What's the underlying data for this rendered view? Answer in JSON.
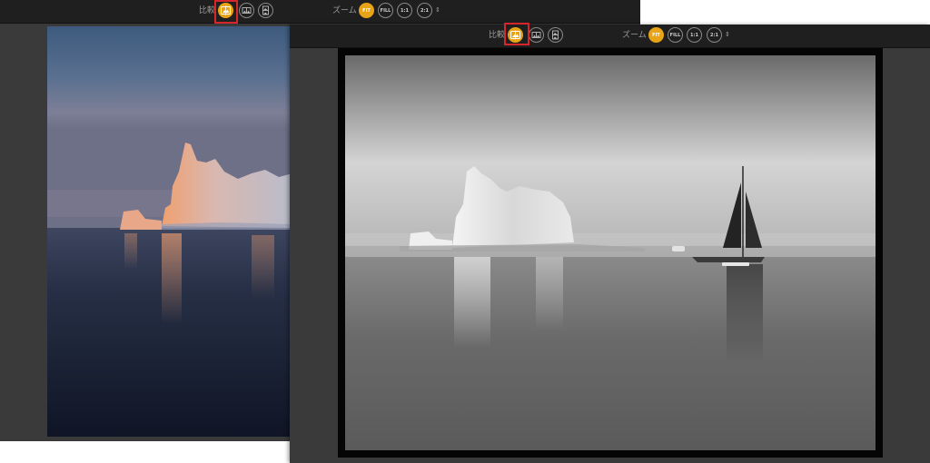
{
  "back_window": {
    "compare_label": "比較",
    "zoom_label": "ズーム",
    "zoom_options": [
      "FIT",
      "FILL",
      "1:1",
      "2:1"
    ],
    "zoom_spinner": "⇕"
  },
  "front_window": {
    "compare_label": "比較",
    "zoom_label": "ズーム",
    "zoom_options": [
      "FIT",
      "FILL",
      "1:1",
      "2:1"
    ],
    "zoom_spinner": "⇕"
  },
  "colors": {
    "accent": "#e8a317",
    "highlight": "#d6252b",
    "toolbar_bg": "#1f1f1f",
    "workspace_bg": "#3a3a3a"
  },
  "icons": {
    "compare_mode": "before-after-split-icon",
    "side_by_side": "side-by-side-icon",
    "stacked": "stacked-view-icon"
  }
}
